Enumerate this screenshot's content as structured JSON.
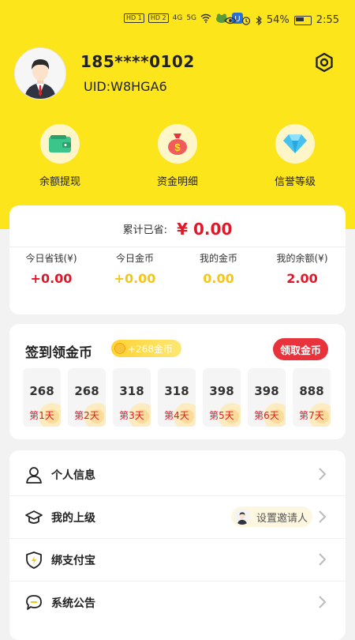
{
  "status_bar": {
    "left_chips": [
      "HD 1",
      "HD 2",
      "4G",
      "5G"
    ],
    "battery": "54%",
    "time": "2:55"
  },
  "profile": {
    "phone": "185****0102",
    "uid": "UID:W8HGA6"
  },
  "quick_actions": [
    {
      "label": "余额提现",
      "icon": "wallet-icon"
    },
    {
      "label": "资金明细",
      "icon": "money-bag-icon"
    },
    {
      "label": "信誉等级",
      "icon": "diamond-icon"
    }
  ],
  "savings": {
    "total_label": "累计已省:",
    "total_value": "¥ 0.00",
    "stats": [
      {
        "label": "今日省钱(¥)",
        "value": "+0.00",
        "color": "#e0192a"
      },
      {
        "label": "今日金币",
        "value": "+0.00",
        "color": "#f4c51a"
      },
      {
        "label": "我的金币",
        "value": "0.00",
        "color": "#f4c51a"
      },
      {
        "label": "我的余额(¥)",
        "value": "2.00",
        "color": "#e0192a"
      }
    ]
  },
  "checkin": {
    "title": "签到领金币",
    "badge": "+268金币",
    "button": "领取金币",
    "days": [
      {
        "amount": "268",
        "label": "第1天"
      },
      {
        "amount": "268",
        "label": "第2天"
      },
      {
        "amount": "318",
        "label": "第3天"
      },
      {
        "amount": "318",
        "label": "第4天"
      },
      {
        "amount": "398",
        "label": "第5天"
      },
      {
        "amount": "398",
        "label": "第6天"
      },
      {
        "amount": "888",
        "label": "第7天"
      }
    ]
  },
  "menu": {
    "items": [
      {
        "label": "个人信息",
        "icon": "user-icon"
      },
      {
        "label": "我的上级",
        "icon": "graduation-cap-icon",
        "extra": "设置邀请人"
      },
      {
        "label": "绑支付宝",
        "icon": "shield-icon"
      },
      {
        "label": "系统公告",
        "icon": "chat-bubble-icon"
      }
    ]
  },
  "colors": {
    "brand_yellow": "#fde51c",
    "accent_red": "#e0192a",
    "coin_yellow": "#f4c51a"
  }
}
